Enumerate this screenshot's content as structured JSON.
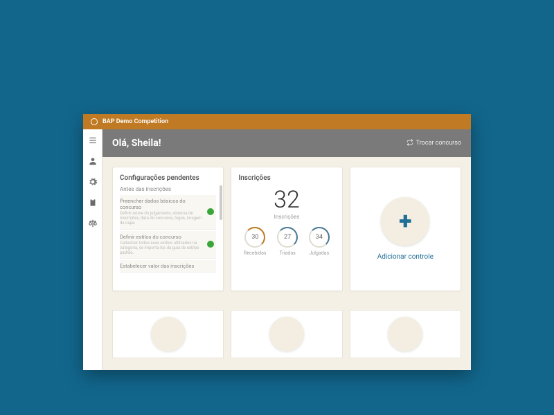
{
  "topbar": {
    "title": "BAP Demo Competition"
  },
  "header": {
    "greeting": "Olá, Sheila!",
    "swap_link": "Trocar concurso"
  },
  "sidebar": {
    "items": [
      {
        "name": "list-icon"
      },
      {
        "name": "user-icon"
      },
      {
        "name": "gear-icon"
      },
      {
        "name": "clipboard-icon"
      },
      {
        "name": "scale-icon"
      }
    ]
  },
  "pending_config": {
    "title": "Configurações pendentes",
    "section_label": "Antes das inscrições",
    "tasks": [
      {
        "title": "Preencher dados básicos do concurso",
        "desc": "Definir nome do julgamento, sistema de inscrições, data do concurso, logos, imagem de capa."
      },
      {
        "title": "Definir estilos do concurso",
        "desc": "Cadastrar todos seus estilos utilizados na categoria, se importa-los da guia de estilos padrão."
      },
      {
        "title": "Estabelecer valor das inscrições",
        "desc": ""
      }
    ]
  },
  "subscriptions": {
    "title": "Inscrições",
    "count": "32",
    "count_label": "Inscrições",
    "stats": [
      {
        "value": "30",
        "label": "Recebidas",
        "color": "#c07a23"
      },
      {
        "value": "27",
        "label": "Triadas",
        "color": "#497a96"
      },
      {
        "value": "34",
        "label": "Julgadas",
        "color": "#497a96"
      }
    ]
  },
  "add_control": {
    "label": "Adicionar controle"
  }
}
